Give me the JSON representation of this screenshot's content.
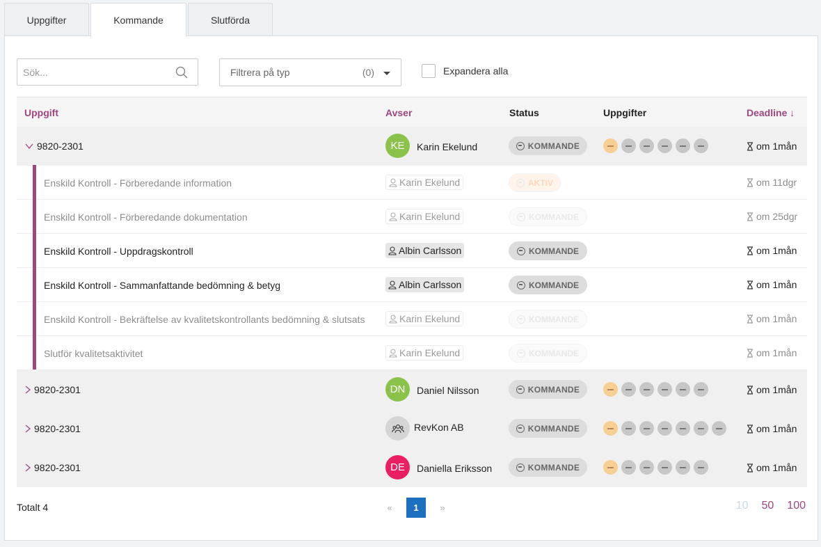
{
  "tabs": [
    "Uppgifter",
    "Kommande",
    "Slutförda"
  ],
  "search": {
    "placeholder": "Sök..."
  },
  "filter": {
    "label": "Filtrera på typ",
    "count": "(0)"
  },
  "expand_all": "Expandera alla",
  "columns": {
    "task": "Uppgift",
    "concerns": "Avser",
    "status": "Status",
    "tasks": "Uppgifter",
    "deadline": "Deadline ↓"
  },
  "groups": [
    {
      "id": "9820-2301",
      "initials": "KE",
      "avatar_color": "#8bc34a",
      "name": "Karin Ekelund",
      "status": "KOMMANDE",
      "deadline": "om 1mån",
      "expanded": true
    },
    {
      "id": "9820-2301",
      "initials": "DN",
      "avatar_color": "#8bc34a",
      "name": "Daniel Nilsson",
      "status": "KOMMANDE",
      "deadline": "om 1mån"
    },
    {
      "id": "9820-2301",
      "initials": "",
      "avatar_icon": "group-icon",
      "avatar_color": "#d5d5d5",
      "name": "RevKon AB",
      "status": "KOMMANDE",
      "deadline": "om 1mån"
    },
    {
      "id": "9820-2301",
      "initials": "DE",
      "avatar_color": "#e91e63",
      "name": "Daniella Eriksson",
      "status": "KOMMANDE",
      "deadline": "om 1mån"
    }
  ],
  "subtasks": [
    {
      "title": "Enskild Kontroll - Förberedande information",
      "person": "Karin Ekelund",
      "status": "AKTIV",
      "deadline": "om 11dgr",
      "faded": true
    },
    {
      "title": "Enskild Kontroll - Förberedande dokumentation",
      "person": "Karin Ekelund",
      "status": "KOMMANDE",
      "deadline": "om 25dgr",
      "faded": true
    },
    {
      "title": "Enskild Kontroll - Uppdragskontroll",
      "person": "Albin Carlsson",
      "status": "KOMMANDE",
      "deadline": "om 1mån",
      "faded": false
    },
    {
      "title": "Enskild Kontroll - Sammanfattande bedömning & betyg",
      "person": "Albin Carlsson",
      "status": "KOMMANDE",
      "deadline": "om 1mån",
      "faded": false
    },
    {
      "title": "Enskild Kontroll - Bekräftelse av kvalitetskontrollants bedömning & slutsats",
      "person": "Karin Ekelund",
      "status": "KOMMANDE",
      "deadline": "om 1mån",
      "faded": true
    },
    {
      "title": "Slutför kvalitetsaktivitet",
      "person": "Karin Ekelund",
      "status": "KOMMANDE",
      "deadline": "om 1mån",
      "faded": true
    }
  ],
  "footer": {
    "total": "Totalt 4",
    "prev": "«",
    "page": "1",
    "next": "»",
    "sizes": [
      "10",
      "50",
      "100"
    ]
  },
  "colors": {
    "accent": "#a0467f",
    "pager_active": "#1c6fbf",
    "orange_dot": "#f7cf94",
    "grey_dot": "#c7c7c7"
  }
}
